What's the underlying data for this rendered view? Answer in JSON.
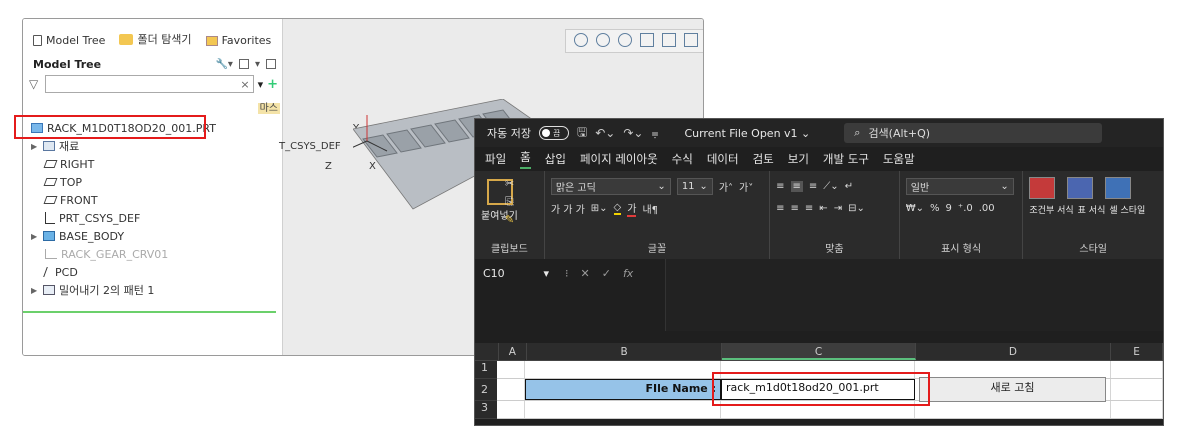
{
  "creo": {
    "tabs": [
      {
        "label": "Model Tree",
        "icon": "model-tree-icon"
      },
      {
        "label": "폴더 탐색기",
        "icon": "folder-icon"
      },
      {
        "label": "Favorites",
        "icon": "favorites-icon"
      }
    ],
    "tree_title": "Model Tree",
    "master_label": "마스",
    "tree_items": [
      {
        "label": "RACK_M1D0T18OD20_001.PRT",
        "icon": "part-icon",
        "level": 0,
        "disabled": false
      },
      {
        "label": "재료",
        "icon": "material-folder-icon",
        "level": 0,
        "arrow": "▶",
        "disabled": false
      },
      {
        "label": "RIGHT",
        "icon": "datum-plane-icon",
        "level": 1,
        "disabled": false
      },
      {
        "label": "TOP",
        "icon": "datum-plane-icon",
        "level": 1,
        "disabled": false
      },
      {
        "label": "FRONT",
        "icon": "datum-plane-icon",
        "level": 1,
        "disabled": false
      },
      {
        "label": "PRT_CSYS_DEF",
        "icon": "csys-icon",
        "level": 1,
        "disabled": false
      },
      {
        "label": "BASE_BODY",
        "icon": "body-icon",
        "level": 0,
        "arrow": "▶",
        "disabled": false
      },
      {
        "label": "RACK_GEAR_CRV01",
        "icon": "curve-icon",
        "level": 1,
        "disabled": true
      },
      {
        "label": "PCD",
        "icon": "sketch-icon",
        "level": 1,
        "disabled": false
      },
      {
        "label": "밀어내기 2의 패턴 1",
        "icon": "pattern-icon",
        "level": 0,
        "arrow": "▶",
        "disabled": false
      }
    ],
    "viewport_labels": {
      "csys": "T_CSYS_DEF",
      "y": "Y",
      "z": "Z",
      "x": "X"
    }
  },
  "excel": {
    "autosave": "자동 저장",
    "toggle": "끔",
    "title": "Current File Open v1 ⌄",
    "search": "검색(Alt+Q)",
    "menu": [
      "파일",
      "홈",
      "삽입",
      "페이지 레이아웃",
      "수식",
      "데이터",
      "검토",
      "보기",
      "개발 도구",
      "도움말"
    ],
    "active_menu": "홈",
    "ribbon": {
      "paste": "붙여넣기",
      "clipboard": "클립보드",
      "font_name": "맑은 고딕",
      "font_size": "11",
      "font_group": "글꼴",
      "align_group": "맞춤",
      "number_format": "일반",
      "number_group": "표시 형식",
      "style_group": "스타일",
      "styles": [
        "조건부 서식",
        "표 서식",
        "셀 스타일"
      ],
      "font_buttons": "가 가 가",
      "currency": "%",
      "comma": "9"
    },
    "name_box": "C10",
    "fx": "fx",
    "columns": [
      "A",
      "B",
      "C",
      "D",
      "E"
    ],
    "rows": [
      "1",
      "2",
      "3"
    ],
    "cells": {
      "B2": "FIle Name :",
      "C2": "rack_m1d0t18od20_001.prt",
      "D2": "새로 고침"
    }
  }
}
